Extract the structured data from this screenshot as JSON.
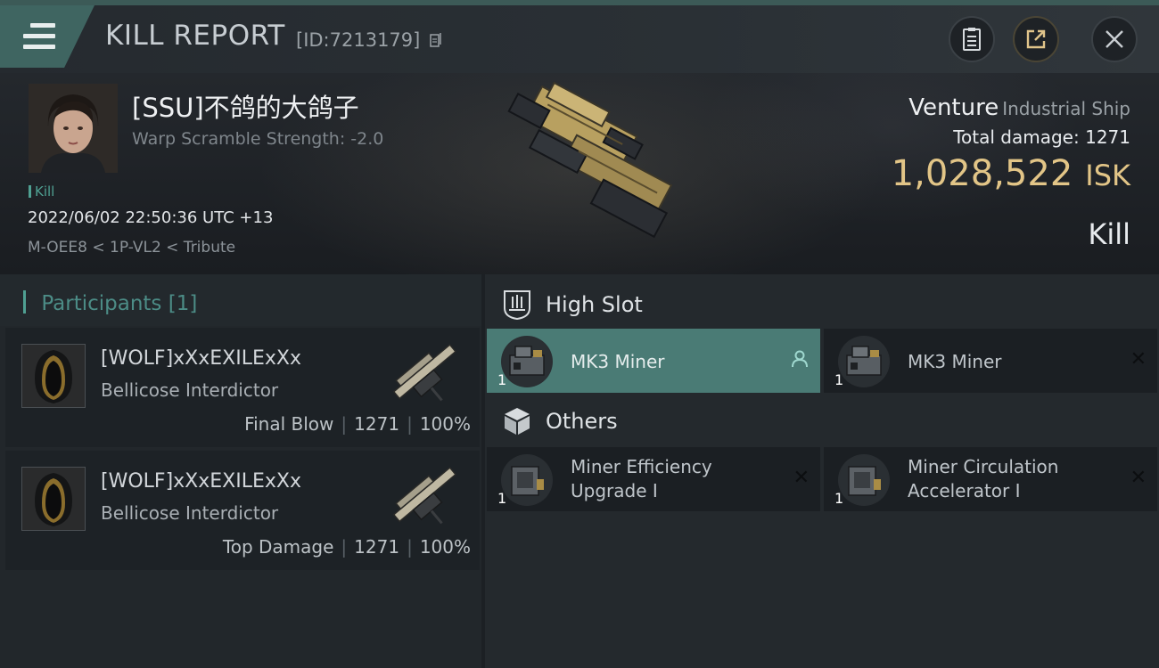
{
  "header": {
    "title": "KILL REPORT",
    "id_text": "[ID:7213179]",
    "icons": [
      "menu-icon",
      "copy-icon",
      "clipboard-icon",
      "share-icon",
      "close-icon"
    ]
  },
  "victim": {
    "name": "[SSU]不鸽的大鸽子",
    "scramble": "Warp Scramble Strength: -2.0",
    "kill_tag": "Kill",
    "datetime": "2022/06/02 22:50:36 UTC +13",
    "location": "M-OEE8 < 1P-VL2 < Tribute"
  },
  "ship": {
    "name": "Venture",
    "class": "Industrial Ship",
    "total_damage_label": "Total damage:",
    "total_damage": "1271",
    "value": "1,028,522",
    "value_unit": "ISK",
    "outcome": "Kill"
  },
  "participants": {
    "label": "Participants",
    "count": "[1]",
    "cards": [
      {
        "name": "[WOLF]xXxEXILExXx",
        "ship": "Bellicose Interdictor",
        "role": "Final Blow",
        "damage": "1271",
        "percent": "100%"
      },
      {
        "name": "[WOLF]xXxEXILExXx",
        "ship": "Bellicose Interdictor",
        "role": "Top Damage",
        "damage": "1271",
        "percent": "100%"
      }
    ]
  },
  "fittings": {
    "high_slot_label": "High Slot",
    "others_label": "Others",
    "high_slot": [
      {
        "qty": "1",
        "name": "MK3 Miner",
        "status": "pilot-icon"
      },
      {
        "qty": "1",
        "name": "MK3 Miner",
        "status": "destroyed-x-icon"
      }
    ],
    "others": [
      {
        "qty": "1",
        "name_line1": "Miner Efficiency",
        "name_line2": "Upgrade I",
        "status": "destroyed-x-icon"
      },
      {
        "qty": "1",
        "name_line1": "Miner Circulation",
        "name_line2": "Accelerator I",
        "status": "destroyed-x-icon"
      }
    ]
  },
  "colors": {
    "accent_teal": "#4a7b75",
    "isk_gold": "#e2c587",
    "panel_dark": "#1b1f23"
  }
}
